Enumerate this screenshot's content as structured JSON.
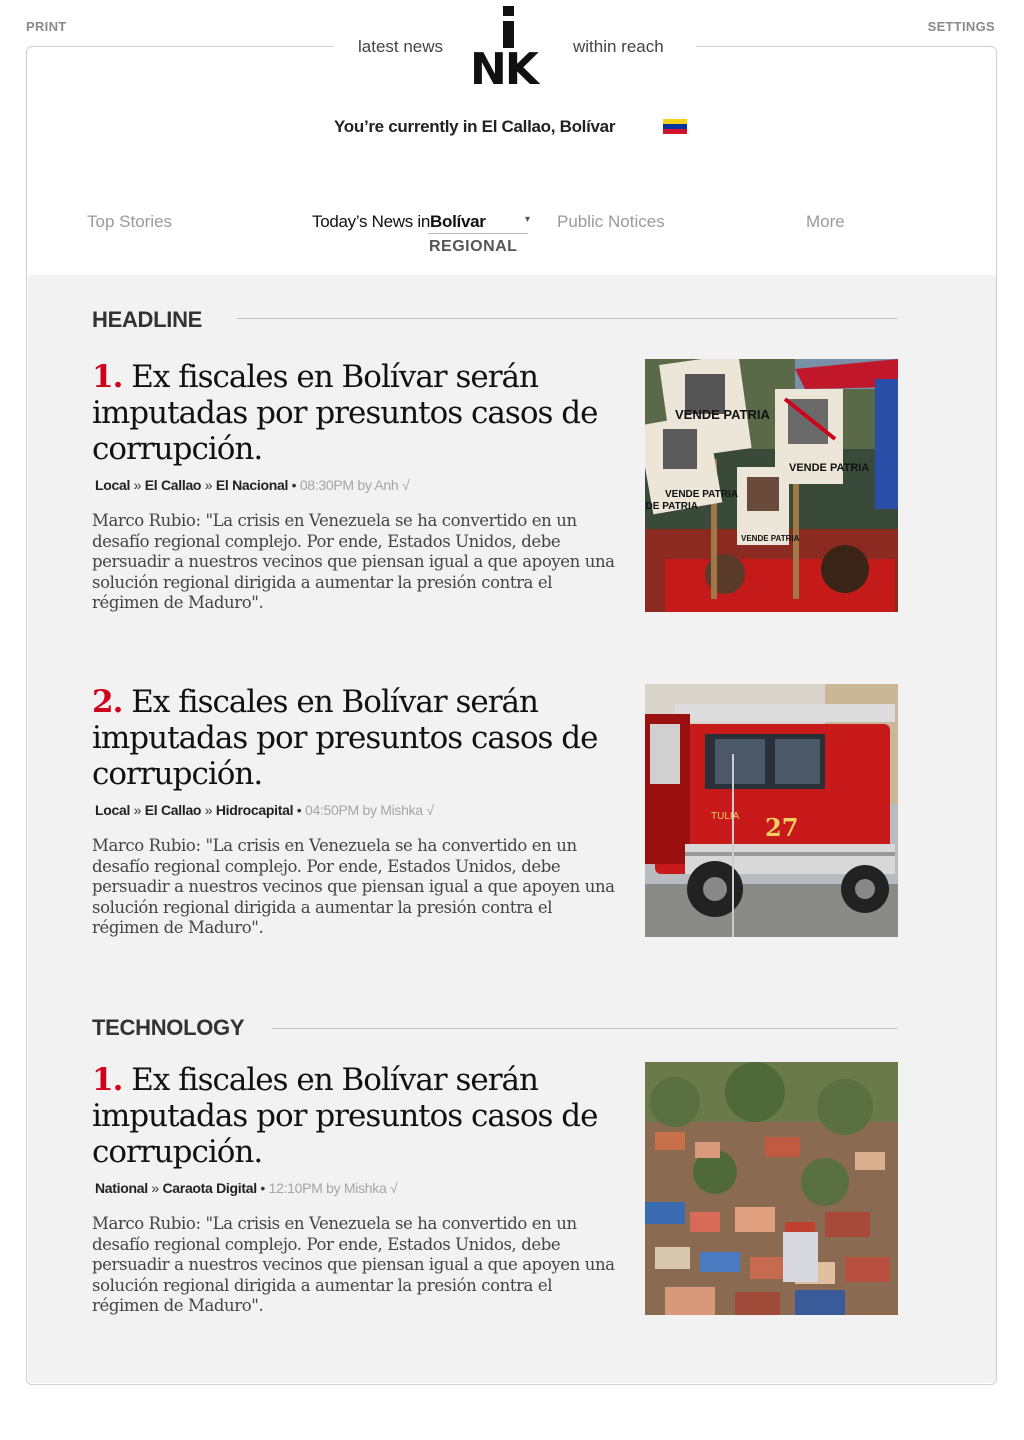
{
  "header": {
    "print_label": "PRINT",
    "settings_label": "SETTINGS",
    "tagline_left": "latest news",
    "tagline_right": "within reach",
    "logo_text": "NK",
    "location_text": "You’re currently in El Callao, Bolívar",
    "flag_colors": [
      "#f7d117",
      "#0033a0",
      "#cf142b"
    ]
  },
  "nav": {
    "top_stories": "Top Stories",
    "todays_news": "Today’s News",
    "in_word": "in",
    "place": "Bolívar",
    "dropdown_glyph": "▾",
    "regional": "REGIONAL",
    "public_notices": "Public Notices",
    "more": "More"
  },
  "sections": [
    {
      "title": "HEADLINE",
      "articles": [
        {
          "number": "1.",
          "title": "Ex fiscales en Bolívar serán imputadas por presuntos casos de corrupción.",
          "sources": [
            "Local",
            "El Callao",
            "El Nacional"
          ],
          "time": "08:30PM by Anh √",
          "body": "Marco Rubio: \"La crisis en Venezuela se ha convertido en un desafío regional complejo. Por ende, Estados Unidos, debe persuadir a nuestros vecinos que piensan igual a que apoyen una solución regional dirigida a aumentar la presión contra el régimen de Maduro\".",
          "image": "protest-photo",
          "image_signs": [
            "VENDE PATRIA",
            "VENDE PATRIA",
            "VENDE PATRIA",
            "VENDE PATRIA",
            "VENDE PATRIA"
          ]
        },
        {
          "number": "2.",
          "title": "Ex fiscales en Bolívar serán imputadas por presuntos casos de corrupción.",
          "sources": [
            "Local",
            "El Callao",
            "Hidrocapital"
          ],
          "time": "04:50PM by Mishka √",
          "body": "Marco Rubio: \"La crisis en Venezuela se ha convertido en un desafío regional complejo. Por ende, Estados Unidos, debe persuadir a nuestros vecinos que piensan igual a que apoyen una solución regional dirigida a aumentar la presión contra el régimen de Maduro\".",
          "image": "fire-truck-photo",
          "image_truck_number": "27",
          "image_truck_label": "TULIA"
        }
      ]
    },
    {
      "title": "TECHNOLOGY",
      "articles": [
        {
          "number": "1.",
          "title": "Ex fiscales en Bolívar serán imputadas por presuntos casos de corrupción.",
          "sources": [
            "National",
            "Caraota Digital"
          ],
          "time": "12:10PM by Mishka √",
          "body": "Marco Rubio: \"La crisis en Venezuela se ha convertido en un desafío regional complejo. Por ende, Estados Unidos, debe persuadir a nuestros vecinos que piensan igual a que apoyen una solución regional dirigida a aumentar la presión contra el régimen de Maduro\".",
          "image": "hillside-city-photo"
        }
      ]
    }
  ]
}
